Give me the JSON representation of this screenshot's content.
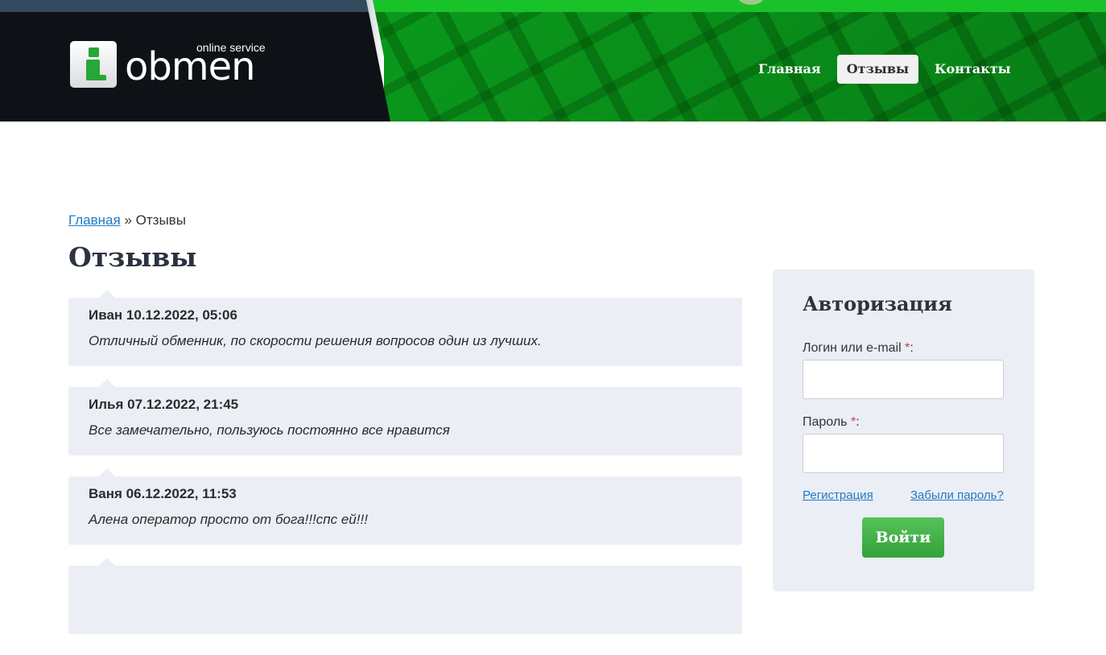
{
  "header": {
    "logo": {
      "letter": "i",
      "word": "obmen",
      "tagline": "online service"
    },
    "nav": [
      {
        "label": "Главная",
        "active": false
      },
      {
        "label": "Отзывы",
        "active": true
      },
      {
        "label": "Контакты",
        "active": false
      }
    ]
  },
  "breadcrumb": {
    "home": "Главная",
    "separator": "»",
    "current": "Отзывы"
  },
  "page_title": "Отзывы",
  "reviews": [
    {
      "author": "Иван",
      "datetime": "10.12.2022, 05:06",
      "text": "Отличный обменник, по скорости решения вопросов один из лучших."
    },
    {
      "author": "Илья",
      "datetime": "07.12.2022, 21:45",
      "text": "Все замечательно, пользуюсь постоянно все нравится"
    },
    {
      "author": "Ваня",
      "datetime": "06.12.2022, 11:53",
      "text": "Алена оператор просто от бога!!!спс ей!!!"
    }
  ],
  "auth": {
    "title": "Авторизация",
    "login_label": "Логин или e-mail",
    "password_label": "Пароль",
    "required_mark": "*",
    "colon": ":",
    "login_value": "",
    "password_value": "",
    "register_link": "Регистрация",
    "forgot_link": "Забыли пароль?",
    "submit_label": "Войти"
  },
  "colors": {
    "accent_green": "#34a23a",
    "link_blue": "#1f7ac4",
    "card_bg": "#ebeef5"
  }
}
